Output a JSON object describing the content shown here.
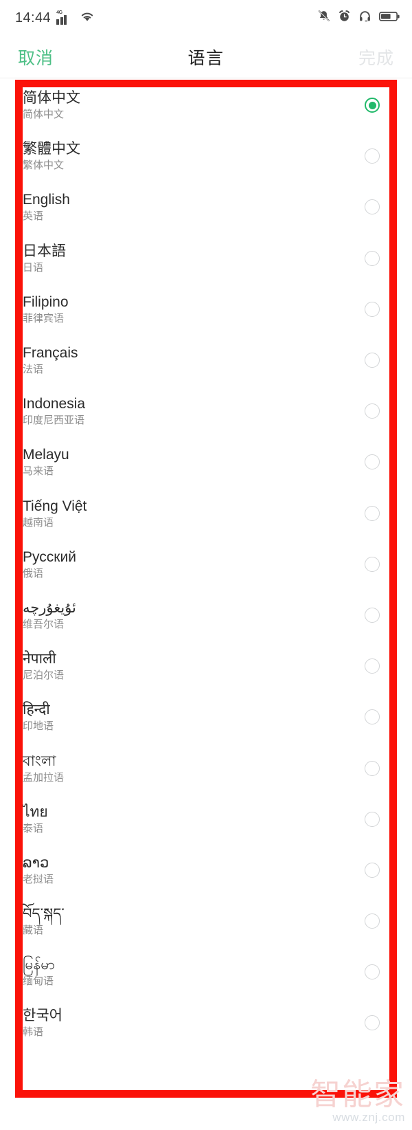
{
  "status_bar": {
    "time": "14:44",
    "network_label": "4G",
    "icons": [
      "signal-4g-icon",
      "wifi-icon",
      "mute-bell-icon",
      "alarm-clock-icon",
      "headphones-icon",
      "battery-icon"
    ]
  },
  "nav": {
    "cancel_label": "取消",
    "title": "语言",
    "done_label": "完成",
    "cancel_color": "#4cbf85",
    "done_color": "#e3e5e7"
  },
  "annotation": {
    "type": "red-rectangle-highlight",
    "color": "#fb1209"
  },
  "selection": {
    "selected_index": 0,
    "selected_color": "#21b96a",
    "unselected_color": "#d2d4d6"
  },
  "languages": [
    {
      "native": "简体中文",
      "chinese": "简体中文",
      "selected": true
    },
    {
      "native": "繁體中文",
      "chinese": "繁体中文",
      "selected": false
    },
    {
      "native": "English",
      "chinese": "英语",
      "selected": false
    },
    {
      "native": "日本語",
      "chinese": "日语",
      "selected": false
    },
    {
      "native": "Filipino",
      "chinese": "菲律宾语",
      "selected": false
    },
    {
      "native": "Français",
      "chinese": "法语",
      "selected": false
    },
    {
      "native": "Indonesia",
      "chinese": "印度尼西亚语",
      "selected": false
    },
    {
      "native": "Melayu",
      "chinese": "马来语",
      "selected": false
    },
    {
      "native": "Tiếng Việt",
      "chinese": "越南语",
      "selected": false
    },
    {
      "native": "Русский",
      "chinese": "俄语",
      "selected": false
    },
    {
      "native": "ئۇيغۇرچە",
      "chinese": "维吾尔语",
      "selected": false
    },
    {
      "native": "नेपाली",
      "chinese": "尼泊尔语",
      "selected": false
    },
    {
      "native": "हिन्दी",
      "chinese": "印地语",
      "selected": false
    },
    {
      "native": "বাংলা",
      "chinese": "孟加拉语",
      "selected": false
    },
    {
      "native": "ไทย",
      "chinese": "泰语",
      "selected": false
    },
    {
      "native": "ລາວ",
      "chinese": "老挝语",
      "selected": false
    },
    {
      "native": "བོད་སྐད་",
      "chinese": "藏语",
      "selected": false
    },
    {
      "native": "မြန်မာ",
      "chinese": "缅甸语",
      "selected": false
    },
    {
      "native": "한국어",
      "chinese": "韩语",
      "selected": false
    }
  ],
  "watermark": {
    "main": "智能家",
    "sub": "www.znj.com"
  }
}
